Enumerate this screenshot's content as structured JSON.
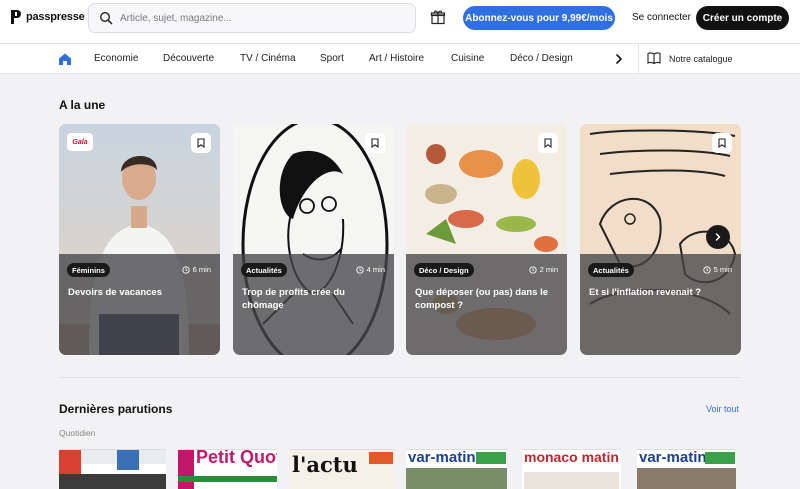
{
  "header": {
    "logo_text": "passpresse",
    "search_placeholder": "Article, sujet, magazine...",
    "subscribe_label": "Abonnez-vous pour 9,99€/mois",
    "login_label": "Se connecter",
    "signup_label": "Créer un compte"
  },
  "nav": {
    "items": [
      "Economie",
      "Découverte",
      "TV / Cinéma",
      "Sport",
      "Art / Histoire",
      "Cuisine",
      "Déco / Design"
    ],
    "catalog_label": "Notre catalogue"
  },
  "featured": {
    "title": "A la une",
    "cards": [
      {
        "tag": "Féminins",
        "duration": "6 min",
        "title": "Devoirs de vacances",
        "logo": "Gala"
      },
      {
        "tag": "Actualités",
        "duration": "4 min",
        "title": "Trop de profits crée du chômage",
        "logo": ""
      },
      {
        "tag": "Déco / Design",
        "duration": "2 min",
        "title": "Que déposer (ou pas) dans le compost ?",
        "logo": ""
      },
      {
        "tag": "Actualités",
        "duration": "5 min",
        "title": "Et si l'inflation revenait ?",
        "logo": ""
      }
    ]
  },
  "latest": {
    "title": "Dernières parutions",
    "see_all": "Voir tout",
    "category": "Quotidien",
    "magazines": [
      "",
      "Petit Quotidien",
      "l'actu",
      "var-matin",
      "monaco matin",
      "var-matin"
    ]
  },
  "colors": {
    "accent": "#2f6fe0",
    "dark_button": "#111111",
    "overlay": "#46464a"
  },
  "icons": {
    "search": "search-icon",
    "gift": "gift-icon",
    "home": "home-icon",
    "bookmark": "bookmark-icon",
    "clock": "clock-icon",
    "chevron": "chevron-right-icon",
    "book": "book-icon"
  }
}
